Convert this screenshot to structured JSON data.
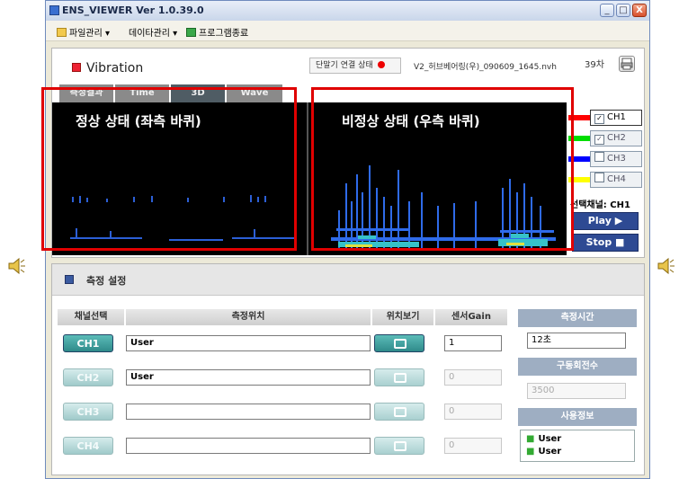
{
  "window": {
    "title": "ENS_VIEWER Ver 1.0.39.0",
    "min_label": "_",
    "max_label": "□",
    "close_label": "X"
  },
  "menu": {
    "items": [
      {
        "label": "파일관리 ▾"
      },
      {
        "label": "데이타관리 ▾"
      },
      {
        "label": "프로그램종료"
      }
    ]
  },
  "vibration": {
    "title": "Vibration",
    "status_label": "단말기 연결 상태",
    "filename": "V2_허브베어링(우)_090609_1645.nvh",
    "count": "39차",
    "tabs": [
      "측정결과",
      "Time",
      "3D",
      "Wave"
    ],
    "overlay_left": "정상 상태 (좌측 바퀴)",
    "overlay_right": "비정상 상태 (우측 바퀴)",
    "channels": [
      {
        "label": "CH1",
        "color": "#ff0000",
        "checked": true,
        "mark": "✓"
      },
      {
        "label": "CH2",
        "color": "#00dd00",
        "checked": true,
        "mark": "✓"
      },
      {
        "label": "CH3",
        "color": "#0000ff",
        "checked": false,
        "mark": ""
      },
      {
        "label": "CH4",
        "color": "#ffff00",
        "checked": false,
        "mark": ""
      }
    ],
    "selected_channel_label": "선택채널:",
    "selected_channel_value": "CH1",
    "play_label": "Play ▶",
    "stop_label": "Stop ■"
  },
  "settings": {
    "title": "측정 설정",
    "headers": {
      "channel": "채널선택",
      "position": "측정위치",
      "view": "위치보기",
      "gain": "센서Gain"
    },
    "rows": [
      {
        "channel": "CH1",
        "position": "User",
        "gain": "1",
        "enabled": true
      },
      {
        "channel": "CH2",
        "position": "User",
        "gain": "0",
        "enabled": false
      },
      {
        "channel": "CH3",
        "position": "",
        "gain": "0",
        "enabled": false
      },
      {
        "channel": "CH4",
        "position": "",
        "gain": "0",
        "enabled": false
      }
    ],
    "measure_time_label": "측정시간",
    "measure_time_value": "12초",
    "rpm_label": "구동회전수",
    "rpm_value": "3500",
    "user_info_label": "사용정보",
    "user_info": [
      "User",
      "User"
    ]
  }
}
